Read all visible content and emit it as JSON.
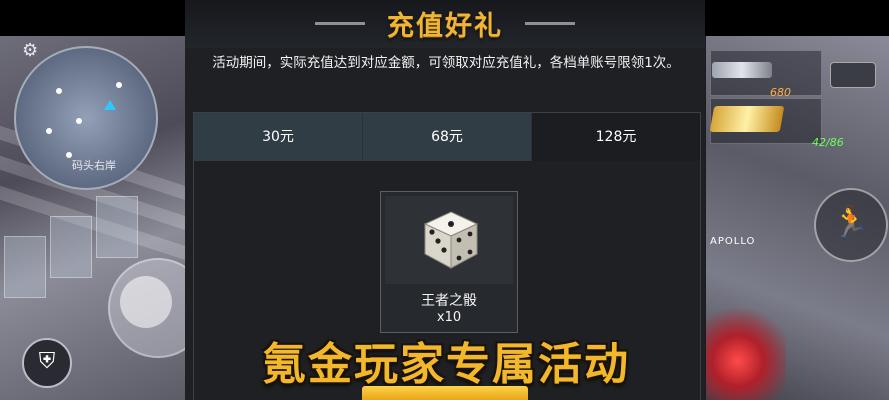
{
  "dialog": {
    "title": "充值好礼",
    "description": "活动期间，实际充值达到对应金额，可领取对应充值礼，各档单账号限领1次。",
    "tabs": [
      {
        "label": "30元"
      },
      {
        "label": "68元"
      },
      {
        "label": "128元"
      }
    ],
    "active_tab": 2,
    "reward": {
      "icon": "dice-icon",
      "name": "王者之骰",
      "quantity": "x10"
    }
  },
  "overlay_caption": "氪金玩家专属活动",
  "game_hud": {
    "map_label": "码头右岸",
    "player_name": "APOLLO",
    "ammo_primary": "680",
    "ammo_secondary": "42/86"
  },
  "colors": {
    "accent_gold": "#f0b436",
    "tab_inactive": "#313d44",
    "tab_active": "#1b1d21",
    "dialog_bg": "#1e2024"
  }
}
